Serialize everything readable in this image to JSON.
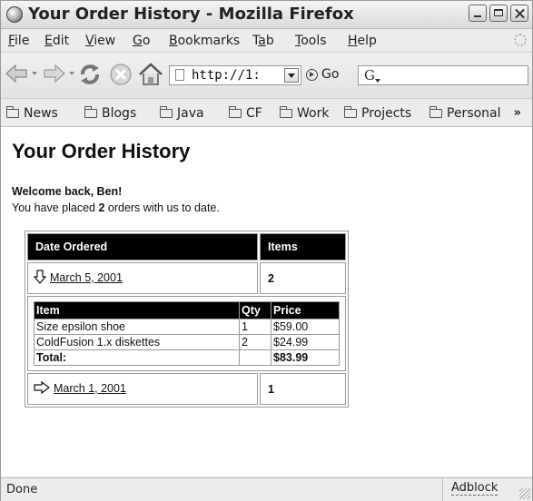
{
  "window": {
    "title": "Your Order History - Mozilla Firefox"
  },
  "menubar": {
    "items": [
      {
        "label": "File",
        "accel": "F",
        "rest": "ile"
      },
      {
        "label": "Edit",
        "accel": "E",
        "rest": "dit"
      },
      {
        "label": "View",
        "accel": "V",
        "rest": "iew"
      },
      {
        "label": "Go",
        "accel": "G",
        "rest": "o"
      },
      {
        "label": "Bookmarks",
        "accel": "B",
        "rest": "ookmarks"
      },
      {
        "label": "Tab",
        "pre": "T",
        "accel": "a",
        "rest": "b"
      },
      {
        "label": "Tools",
        "accel": "T",
        "rest": "ools"
      },
      {
        "label": "Help",
        "accel": "H",
        "rest": "elp"
      }
    ]
  },
  "navbar": {
    "url": "http://1:",
    "go_label": "Go",
    "search_icon_text": "G"
  },
  "bookmarks": {
    "items": [
      "News",
      "Blogs",
      "Java",
      "CF",
      "Work",
      "Projects",
      "Personal"
    ],
    "overflow": "»"
  },
  "page": {
    "title": "Your Order History",
    "welcome": "Welcome back, Ben!",
    "placed_prefix": "You have placed ",
    "placed_count": "2",
    "placed_suffix": " orders with us to date."
  },
  "orders_table": {
    "headers": {
      "date": "Date Ordered",
      "items": "Items"
    },
    "orders": [
      {
        "date": "March 5, 2001",
        "items": "2",
        "expanded": true
      },
      {
        "date": "March 1, 2001",
        "items": "1",
        "expanded": false
      }
    ],
    "detail": {
      "headers": {
        "item": "Item",
        "qty": "Qty",
        "price": "Price"
      },
      "rows": [
        {
          "item": "Size epsilon shoe",
          "qty": "1",
          "price": "$59.00"
        },
        {
          "item": "ColdFusion 1.x diskettes",
          "qty": "2",
          "price": "$24.99"
        }
      ],
      "total_label": "Total:",
      "total_value": "$83.99"
    }
  },
  "statusbar": {
    "status": "Done",
    "adblock": "Adblock"
  },
  "colors": {
    "header_bg": "#000000",
    "header_fg": "#ffffff",
    "chrome_bg": "#ececec"
  }
}
